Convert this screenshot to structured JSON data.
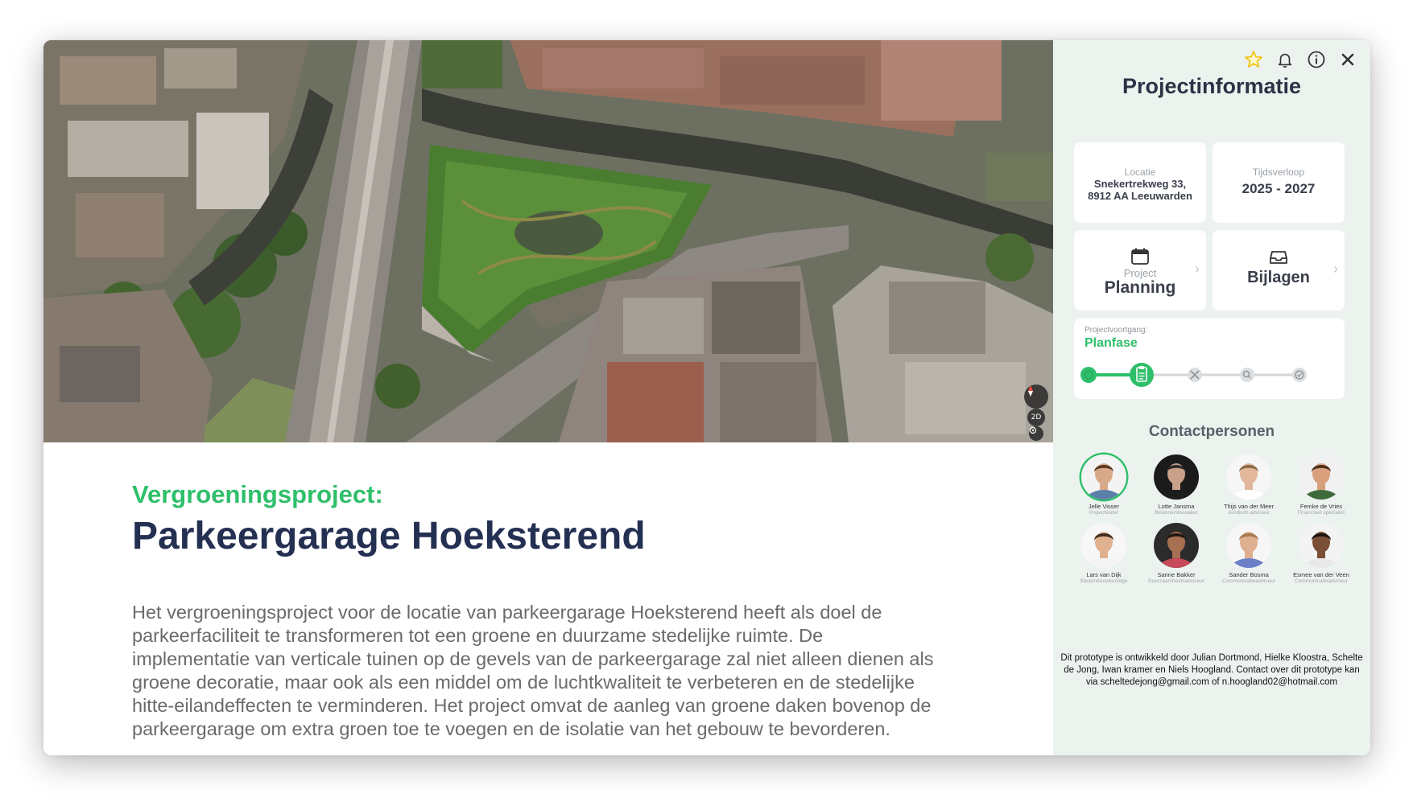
{
  "map": {
    "view_toggle": "2D",
    "compass_icon": "compass-icon",
    "locate_icon": "locate-icon"
  },
  "project": {
    "subtitle": "Vergroeningsproject:",
    "title": "Parkeergarage Hoeksterend",
    "description": "Het vergroeningsproject voor de locatie van parkeergarage Hoeksterend heeft als doel de parkeerfaciliteit te transformeren tot een groene en duurzame stedelijke ruimte. De implementatie van verticale tuinen op de gevels van de parkeergarage zal niet alleen dienen als groene decoratie, maar ook als een middel om de luchtkwaliteit te verbeteren en de stedelijke hitte-eilandeffecten te verminderen. Het project omvat de aanleg van groene daken bovenop de parkeergarage om extra groen toe te voegen en de isolatie van het gebouw te bevorderen."
  },
  "sidebar": {
    "title": "Projectinformatie",
    "icons": [
      "star-icon",
      "bell-icon",
      "info-icon",
      "close-icon"
    ],
    "location": {
      "label": "Locatie",
      "line1": "Snekertrekweg 33,",
      "line2": "8912 AA Leeuwarden"
    },
    "timeline": {
      "label": "Tijdsverloop",
      "value": "2025 - 2027"
    },
    "planning": {
      "small": "Project",
      "label": "Planning"
    },
    "attachments": {
      "label": "Bijlagen"
    },
    "progress": {
      "label": "Projectvoortgang:",
      "phase": "Planfase",
      "current_step": 2,
      "total_steps": 5,
      "step_icons": [
        "check-icon",
        "clipboard-icon",
        "tools-icon",
        "search-icon",
        "check-circle-icon"
      ]
    },
    "contacts_title": "Contactpersonen",
    "contacts": [
      {
        "name": "Jelle Visser",
        "role": "Projectleider",
        "skin": "#d8a988",
        "hair": "#5a3a22",
        "shirt": "#5a7fa8",
        "bg": "#f3f3f3"
      },
      {
        "name": "Lotte Jansma",
        "role": "Bewonersbewaker",
        "skin": "#c9a08a",
        "hair": "#2a2a2a",
        "shirt": "#1d1d1d",
        "bg": "#1b1b1b"
      },
      {
        "name": "Thijs van der Meer",
        "role": "Juridisch adviseur",
        "skin": "#e3b79c",
        "hair": "#8a6a4a",
        "shirt": "#ffffff",
        "bg": "#f6f6f6"
      },
      {
        "name": "Femke de Vries",
        "role": "Financieel specialist",
        "skin": "#d9a07d",
        "hair": "#4a2e1c",
        "shirt": "#3f6b3c",
        "bg": "#f1f1f1"
      },
      {
        "name": "Lars van Dijk",
        "role": "Stedenbouwkundige",
        "skin": "#e0b08f",
        "hair": "#3b2a1f",
        "shirt": "#f4f4f4",
        "bg": "#f7f7f7"
      },
      {
        "name": "Sanne Bakker",
        "role": "Duurzaamheidsadviseur",
        "skin": "#a87052",
        "hair": "#1f140e",
        "shirt": "#c74a5c",
        "bg": "#2b2b2b"
      },
      {
        "name": "Sander Bosma",
        "role": "Communicatieadviseur",
        "skin": "#e0ae90",
        "hair": "#a47a52",
        "shirt": "#6a7fc8",
        "bg": "#f6f6f6"
      },
      {
        "name": "Esmee van der Veen",
        "role": "Communicatieadviseur",
        "skin": "#7a4f36",
        "hair": "#1a120d",
        "shirt": "#e8e8e8",
        "bg": "#f3f3f3"
      }
    ],
    "footer": "Dit prototype is ontwikkeld door Julian Dortmond, Hielke Kloostra, Schelte de Jong, Iwan kramer en Niels Hoogland. Contact over dit prototype kan via scheltedejong@gmail.com of n.hoogland02@hotmail.com"
  },
  "colors": {
    "accent": "#2fbf6a",
    "title": "#243052",
    "sidebar_bg": "#ecf3ef"
  }
}
